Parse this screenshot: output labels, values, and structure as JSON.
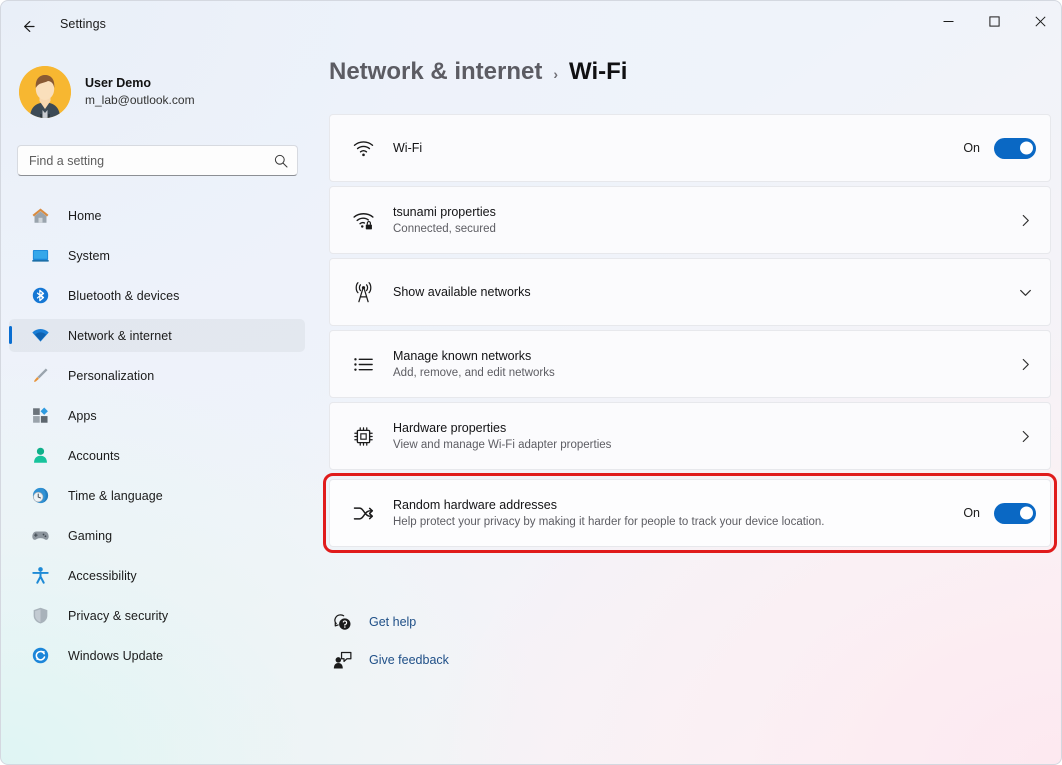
{
  "window": {
    "title": "Settings",
    "back_icon": "arrow-left-icon",
    "controls": {
      "minimize": "minimize-icon",
      "maximize": "maximize-icon",
      "close": "close-icon"
    }
  },
  "sidebar": {
    "profile": {
      "name": "User Demo",
      "email": "m_lab@outlook.com",
      "avatar_icon": "user-avatar"
    },
    "search": {
      "placeholder": "Find a setting",
      "value": "",
      "icon": "search-icon"
    },
    "items": [
      {
        "label": "Home",
        "icon": "home-icon",
        "active": false
      },
      {
        "label": "System",
        "icon": "system-icon",
        "active": false
      },
      {
        "label": "Bluetooth & devices",
        "icon": "bluetooth-icon",
        "active": false
      },
      {
        "label": "Network & internet",
        "icon": "wifi-icon",
        "active": true
      },
      {
        "label": "Personalization",
        "icon": "paintbrush-icon",
        "active": false
      },
      {
        "label": "Apps",
        "icon": "apps-icon",
        "active": false
      },
      {
        "label": "Accounts",
        "icon": "accounts-icon",
        "active": false
      },
      {
        "label": "Time & language",
        "icon": "clock-globe-icon",
        "active": false
      },
      {
        "label": "Gaming",
        "icon": "gamepad-icon",
        "active": false
      },
      {
        "label": "Accessibility",
        "icon": "accessibility-icon",
        "active": false
      },
      {
        "label": "Privacy & security",
        "icon": "shield-icon",
        "active": false
      },
      {
        "label": "Windows Update",
        "icon": "update-icon",
        "active": false
      }
    ]
  },
  "main": {
    "breadcrumb": {
      "parent": "Network & internet",
      "separator": "›",
      "current": "Wi-Fi"
    },
    "cards": [
      {
        "title": "Wi-Fi",
        "subtitle": "",
        "icon": "wifi-signal-icon",
        "control": "toggle",
        "toggle_label": "On",
        "toggle_state": "on"
      },
      {
        "title": "tsunami properties",
        "subtitle": "Connected, secured",
        "icon": "wifi-lock-icon",
        "control": "chevron-right"
      },
      {
        "title": "Show available networks",
        "subtitle": "",
        "icon": "broadcast-tower-icon",
        "control": "chevron-down"
      },
      {
        "title": "Manage known networks",
        "subtitle": "Add, remove, and edit networks",
        "icon": "list-icon",
        "control": "chevron-right"
      },
      {
        "title": "Hardware properties",
        "subtitle": "View and manage Wi-Fi adapter properties",
        "icon": "chip-icon",
        "control": "chevron-right"
      },
      {
        "title": "Random hardware addresses",
        "subtitle": "Help protect your privacy by making it harder for people to track your device location.",
        "icon": "shuffle-icon",
        "control": "toggle",
        "toggle_label": "On",
        "toggle_state": "on",
        "highlighted": true
      }
    ],
    "links": [
      {
        "label": "Get help",
        "icon": "help-icon"
      },
      {
        "label": "Give feedback",
        "icon": "feedback-icon"
      }
    ]
  },
  "colors": {
    "accent": "#0a68c4",
    "highlight_border": "#e01b1b",
    "link": "#1f4f87",
    "avatar_bg": "#f7b731"
  }
}
